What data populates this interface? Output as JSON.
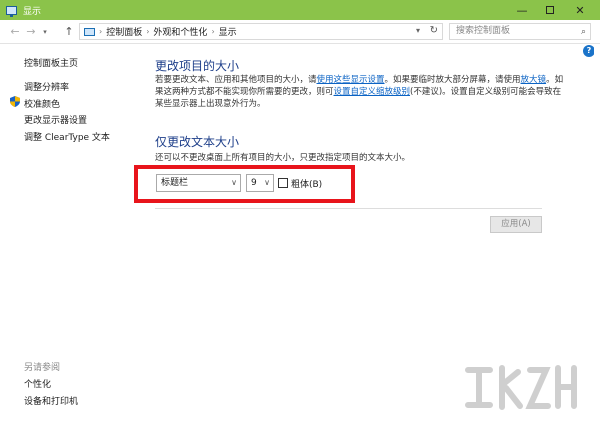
{
  "window": {
    "title": "显示"
  },
  "nav": {
    "back": "←",
    "forward": "→",
    "dropdown": "▾",
    "up": "↑"
  },
  "address": {
    "crumbs": [
      "控制面板",
      "外观和个性化",
      "显示"
    ],
    "separator": "›"
  },
  "search": {
    "placeholder": "搜索控制面板"
  },
  "sidebar": {
    "home": "控制面板主页",
    "items": [
      "调整分辨率",
      "校准颜色",
      "更改显示器设置",
      "调整 ClearType 文本"
    ],
    "see_also": "另请参阅",
    "see_also_items": [
      "个性化",
      "设备和打印机"
    ]
  },
  "section1": {
    "title": "更改项目的大小",
    "p1": "若要更改文本、应用和其他项目的大小，请",
    "link1": "使用这些显示设置",
    "p2": "。如果要临时放大部分屏幕，请使用",
    "link2": "放大镜",
    "p3": "。如果这两种方式都不能实现你所需要的更改，则可",
    "link3": "设置自定义缩放级别",
    "p4": "(不建议)。设置自定义级别可能会导致在某些显示器上出现意外行为。"
  },
  "section2": {
    "title": "仅更改文本大小",
    "hint": "还可以不更改桌面上所有项目的大小，只更改指定项目的文本大小。",
    "item_select": "标题栏",
    "size_select": "9",
    "bold_label": "粗体(B)",
    "bold_checked": false
  },
  "apply_label": "应用(A)",
  "colors": {
    "titlebar": "#8bc34a",
    "highlight": "#e8141b",
    "heading": "#1e3f8a",
    "link": "#0b63c4"
  }
}
